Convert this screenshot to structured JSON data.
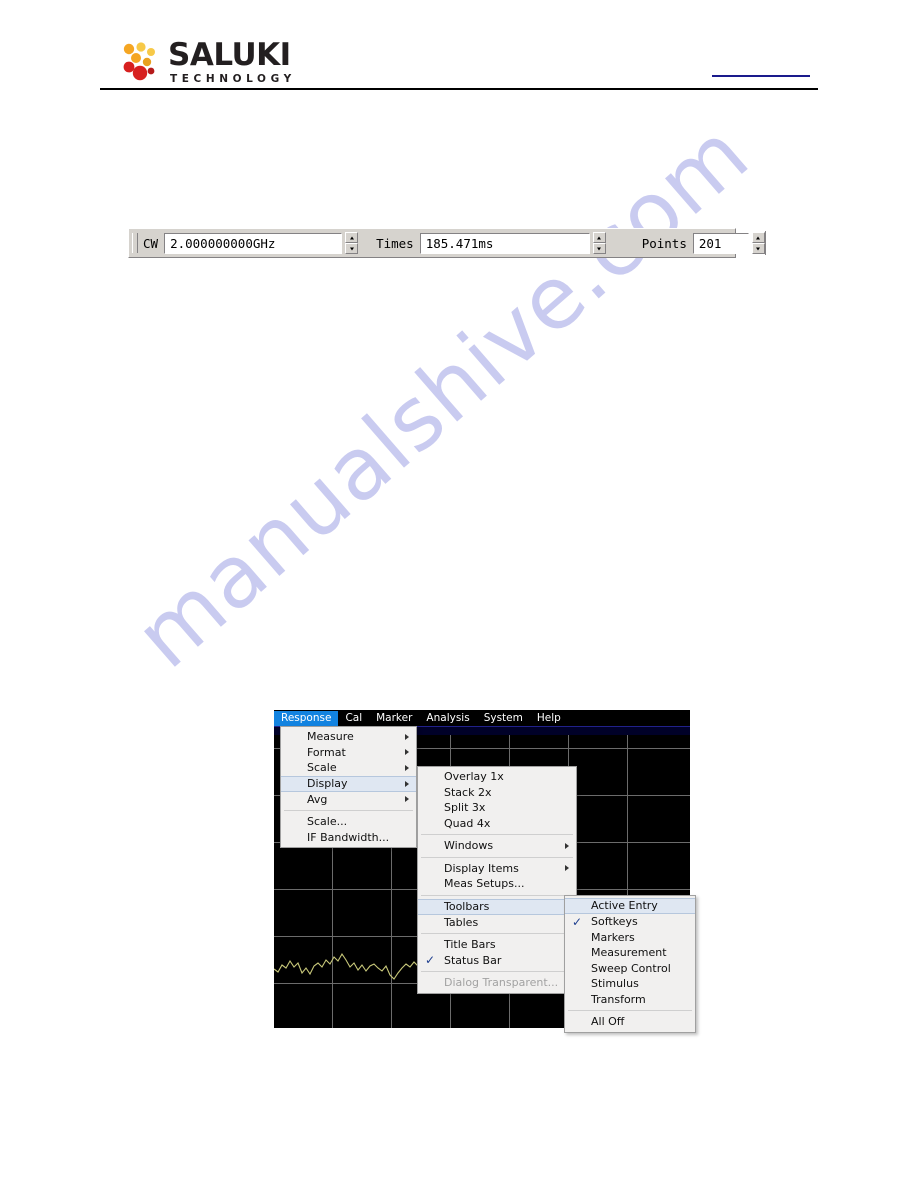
{
  "header": {
    "logo_name": "SALUKI",
    "logo_sub": "TECHNOLOGY",
    "logo_colors": {
      "orange": "#F5A623",
      "yellow": "#F7C948",
      "red": "#D7201F",
      "dark_red": "#B51A1A",
      "text": "#231F20"
    },
    "blue_rule_color": "#1A1A8C"
  },
  "watermark": {
    "text": "manualshive.com",
    "color": "#C9CBF0"
  },
  "stimulus_toolbar": {
    "cw_label": "CW",
    "cw_value": "2.000000000GHz",
    "times_label": "Times",
    "times_value": "185.471ms",
    "points_label": "Points",
    "points_value": "201"
  },
  "vna": {
    "menu_bar": [
      {
        "label": "Response",
        "active": true
      },
      {
        "label": "Cal",
        "active": false
      },
      {
        "label": "Marker",
        "active": false
      },
      {
        "label": "Analysis",
        "active": false
      },
      {
        "label": "System",
        "active": false
      },
      {
        "label": "Help",
        "active": false
      }
    ],
    "response_menu": [
      {
        "label": "Measure",
        "submenu": true,
        "checked": false,
        "disabled": false,
        "highlight": false
      },
      {
        "label": "Format",
        "submenu": true,
        "checked": false,
        "disabled": false,
        "highlight": false
      },
      {
        "label": "Scale",
        "submenu": true,
        "checked": false,
        "disabled": false,
        "highlight": false
      },
      {
        "label": "Display",
        "submenu": true,
        "checked": false,
        "disabled": false,
        "highlight": true
      },
      {
        "label": "Avg",
        "submenu": true,
        "checked": false,
        "disabled": false,
        "highlight": false
      },
      {
        "separator": true
      },
      {
        "label": "Scale...",
        "submenu": false,
        "checked": false,
        "disabled": false,
        "highlight": false
      },
      {
        "label": "IF Bandwidth...",
        "submenu": false,
        "checked": false,
        "disabled": false,
        "highlight": false
      }
    ],
    "display_menu": [
      {
        "label": "Overlay 1x",
        "submenu": false,
        "checked": false,
        "disabled": false,
        "highlight": false
      },
      {
        "label": "Stack 2x",
        "submenu": false,
        "checked": false,
        "disabled": false,
        "highlight": false
      },
      {
        "label": "Split 3x",
        "submenu": false,
        "checked": false,
        "disabled": false,
        "highlight": false
      },
      {
        "label": "Quad 4x",
        "submenu": false,
        "checked": false,
        "disabled": false,
        "highlight": false
      },
      {
        "separator": true
      },
      {
        "label": "Windows",
        "submenu": true,
        "checked": false,
        "disabled": false,
        "highlight": false
      },
      {
        "separator": true
      },
      {
        "label": "Display Items",
        "submenu": true,
        "checked": false,
        "disabled": false,
        "highlight": false
      },
      {
        "label": "Meas Setups...",
        "submenu": false,
        "checked": false,
        "disabled": false,
        "highlight": false
      },
      {
        "separator": true
      },
      {
        "label": "Toolbars",
        "submenu": true,
        "checked": false,
        "disabled": false,
        "highlight": true
      },
      {
        "label": "Tables",
        "submenu": true,
        "checked": false,
        "disabled": false,
        "highlight": false
      },
      {
        "separator": true
      },
      {
        "label": "Title Bars",
        "submenu": false,
        "checked": false,
        "disabled": false,
        "highlight": false
      },
      {
        "label": "Status Bar",
        "submenu": false,
        "checked": true,
        "disabled": false,
        "highlight": false
      },
      {
        "separator": true
      },
      {
        "label": "Dialog Transparent...",
        "submenu": false,
        "checked": false,
        "disabled": true,
        "highlight": false
      }
    ],
    "toolbars_menu": [
      {
        "label": "Active Entry",
        "submenu": false,
        "checked": false,
        "disabled": false,
        "highlight": true
      },
      {
        "label": "Softkeys",
        "submenu": false,
        "checked": true,
        "disabled": false,
        "highlight": false
      },
      {
        "label": "Markers",
        "submenu": false,
        "checked": false,
        "disabled": false,
        "highlight": false
      },
      {
        "label": "Measurement",
        "submenu": false,
        "checked": false,
        "disabled": false,
        "highlight": false
      },
      {
        "label": "Sweep Control",
        "submenu": false,
        "checked": false,
        "disabled": false,
        "highlight": false
      },
      {
        "label": "Stimulus",
        "submenu": false,
        "checked": false,
        "disabled": false,
        "highlight": false
      },
      {
        "label": "Transform",
        "submenu": false,
        "checked": false,
        "disabled": false,
        "highlight": false
      },
      {
        "separator": true
      },
      {
        "label": "All Off",
        "submenu": false,
        "checked": false,
        "disabled": false,
        "highlight": false
      }
    ],
    "grid": {
      "columns": 7,
      "rows": 6,
      "background": "#000000",
      "line_color": "#6B6B6B",
      "trace_color": "#C8C87A"
    }
  }
}
